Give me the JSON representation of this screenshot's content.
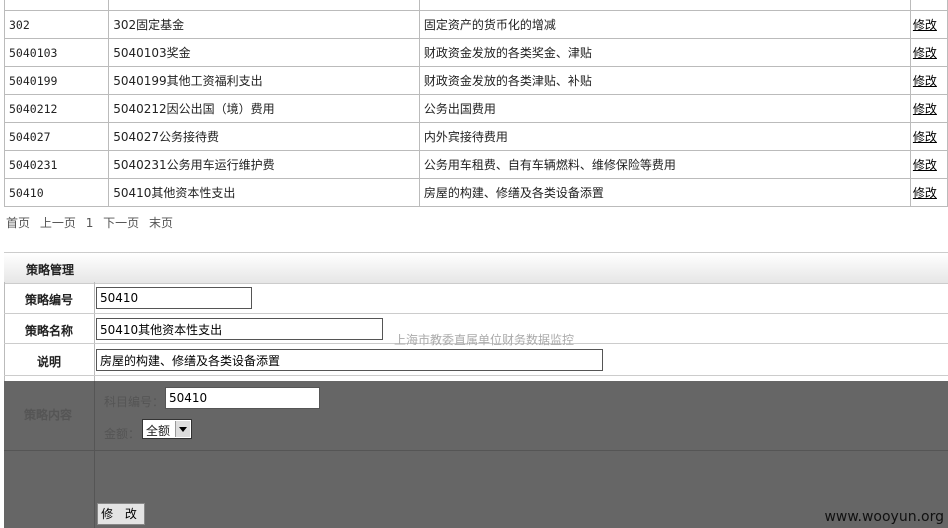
{
  "table": {
    "rows": [
      {
        "code": "",
        "name": "",
        "desc": "",
        "action": ""
      },
      {
        "code": "302",
        "name": "302固定基金",
        "desc": "固定资产的货币化的增减",
        "action": "修改"
      },
      {
        "code": "5040103",
        "name": "5040103奖金",
        "desc": "财政资金发放的各类奖金、津贴",
        "action": "修改"
      },
      {
        "code": "5040199",
        "name": "5040199其他工资福利支出",
        "desc": "财政资金发放的各类津贴、补贴",
        "action": "修改"
      },
      {
        "code": "5040212",
        "name": "5040212因公出国（境）费用",
        "desc": "公务出国费用",
        "action": "修改"
      },
      {
        "code": "504027",
        "name": "504027公务接待费",
        "desc": "内外宾接待费用",
        "action": "修改"
      },
      {
        "code": "5040231",
        "name": "5040231公务用车运行维护费",
        "desc": "公务用车租费、自有车辆燃料、维修保险等费用",
        "action": "修改"
      },
      {
        "code": "50410",
        "name": "50410其他资本性支出",
        "desc": "房屋的构建、修缮及各类设备添置",
        "action": "修改"
      }
    ]
  },
  "pager": {
    "first": "首页",
    "prev": "上一页",
    "page": "1",
    "next": "下一页",
    "last": "末页"
  },
  "form": {
    "title": "策略管理",
    "id_label": "策略编号",
    "id_value": "50410",
    "name_label": "策略名称",
    "name_value": "50410其他资本性支出",
    "desc_label": "说明",
    "desc_value": "房屋的构建、修缮及各类设备添置",
    "content_label": "策略内容",
    "subject_label": "科目编号：",
    "subject_value": "50410",
    "amount_label": "金额：",
    "amount_value": "全额",
    "submit_label": "修 改"
  },
  "watermarks": {
    "middle": "上海市教委直属单位财务数据监控",
    "bottom": "www.wooyun.org"
  }
}
